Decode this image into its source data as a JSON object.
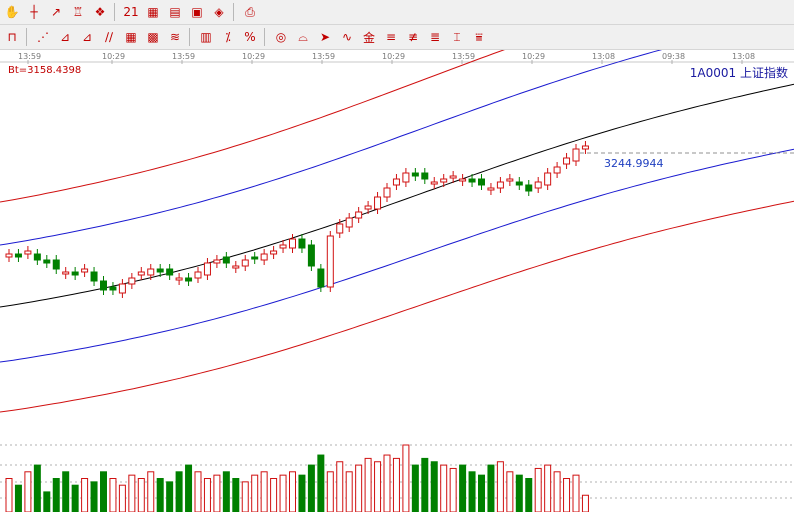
{
  "toolbar_row1": {
    "buttons": [
      {
        "name": "hand-icon",
        "glyph": "✋"
      },
      {
        "name": "crosshair-icon",
        "glyph": "┼"
      },
      {
        "name": "line-tool-icon",
        "glyph": "↗"
      },
      {
        "name": "candle-style-icon",
        "glyph": "♖"
      },
      {
        "name": "indicator-icon",
        "glyph": "❖"
      },
      {
        "name": "calendar-icon",
        "glyph": "21"
      },
      {
        "name": "calculator-icon",
        "glyph": "▦"
      },
      {
        "name": "data-table-icon",
        "glyph": "▤"
      },
      {
        "name": "save-disk-icon",
        "glyph": "▣"
      },
      {
        "name": "network-icon",
        "glyph": "◈"
      },
      {
        "name": "print-icon",
        "glyph": "⎙"
      }
    ]
  },
  "toolbar_row2": {
    "buttons": [
      {
        "name": "fib-line-icon",
        "glyph": "⊓"
      },
      {
        "name": "fan-line-icon",
        "glyph": "⋰"
      },
      {
        "name": "gann-fan-icon",
        "glyph": "⊿"
      },
      {
        "name": "speed-line-icon",
        "glyph": "⊿"
      },
      {
        "name": "parallel-line-icon",
        "glyph": "∕∕"
      },
      {
        "name": "grid-icon",
        "glyph": "▦"
      },
      {
        "name": "box-grid-icon",
        "glyph": "▩"
      },
      {
        "name": "channel-icon",
        "glyph": "≋"
      },
      {
        "name": "bars-icon",
        "glyph": "▥"
      },
      {
        "name": "percent-tool-icon",
        "glyph": "⁒"
      },
      {
        "name": "percent-icon",
        "glyph": "%"
      },
      {
        "name": "circle-cycle-icon",
        "glyph": "◎"
      },
      {
        "name": "golden-ratio-icon",
        "glyph": "⌓"
      },
      {
        "name": "arrow-tool-icon",
        "glyph": "➤"
      },
      {
        "name": "wave-icon",
        "glyph": "∿"
      },
      {
        "name": "gold-split-icon",
        "glyph": "金"
      },
      {
        "name": "level-line-icon",
        "glyph": "≡"
      },
      {
        "name": "support-line-icon",
        "glyph": "≢"
      },
      {
        "name": "stack-line-icon",
        "glyph": "≣"
      },
      {
        "name": "resistance-icon",
        "glyph": "⌶"
      },
      {
        "name": "cycle-line-icon",
        "glyph": "⩸"
      }
    ]
  },
  "chart_header": {
    "bt_label": "Bt=3158.4398",
    "symbol": "1A0001  上证指数",
    "last_value": "3244.9944"
  },
  "time_ticks": [
    "13:59",
    "10:29",
    "13:59",
    "10:29",
    "13:59",
    "10:29",
    "13:59",
    "10:29",
    "13:08",
    "09:38",
    "13:08"
  ],
  "chart_data": {
    "type": "line",
    "title": "1A0001 上证指数",
    "reference_value": 3158.4398,
    "last_value": 3244.9944,
    "x_ticks": [
      "13:59",
      "10:29",
      "13:59",
      "10:29",
      "13:59",
      "10:29",
      "13:59",
      "10:29",
      "13:08",
      "09:38",
      "13:08"
    ],
    "candles_close_relative": [
      0.42,
      0.41,
      0.43,
      0.4,
      0.39,
      0.37,
      0.36,
      0.35,
      0.37,
      0.33,
      0.3,
      0.3,
      0.32,
      0.34,
      0.36,
      0.37,
      0.36,
      0.35,
      0.34,
      0.33,
      0.36,
      0.39,
      0.4,
      0.39,
      0.38,
      0.4,
      0.41,
      0.42,
      0.43,
      0.45,
      0.47,
      0.44,
      0.38,
      0.31,
      0.48,
      0.52,
      0.54,
      0.56,
      0.58,
      0.61,
      0.64,
      0.67,
      0.69,
      0.68,
      0.67,
      0.66,
      0.67,
      0.68,
      0.67,
      0.66,
      0.65,
      0.64,
      0.66,
      0.67,
      0.65,
      0.63,
      0.66,
      0.69,
      0.71,
      0.74,
      0.77,
      0.78
    ],
    "volume_relative": [
      0.5,
      0.4,
      0.6,
      0.7,
      0.3,
      0.5,
      0.6,
      0.4,
      0.5,
      0.45,
      0.6,
      0.5,
      0.4,
      0.55,
      0.5,
      0.6,
      0.5,
      0.45,
      0.6,
      0.7,
      0.6,
      0.5,
      0.55,
      0.6,
      0.5,
      0.45,
      0.55,
      0.6,
      0.5,
      0.55,
      0.6,
      0.55,
      0.7,
      0.85,
      0.6,
      0.75,
      0.6,
      0.7,
      0.8,
      0.75,
      0.85,
      0.8,
      1.0,
      0.7,
      0.8,
      0.75,
      0.7,
      0.65,
      0.7,
      0.6,
      0.55,
      0.7,
      0.75,
      0.6,
      0.55,
      0.5,
      0.65,
      0.7,
      0.6,
      0.5,
      0.55,
      0.25
    ],
    "grid": true,
    "legend": "none"
  },
  "colors": {
    "up": "#d01010",
    "down": "#008000",
    "outer_band": "#d01010",
    "inner_band": "#1a1ad0",
    "mid_line": "#000000",
    "accent_text": "#2040c0"
  }
}
